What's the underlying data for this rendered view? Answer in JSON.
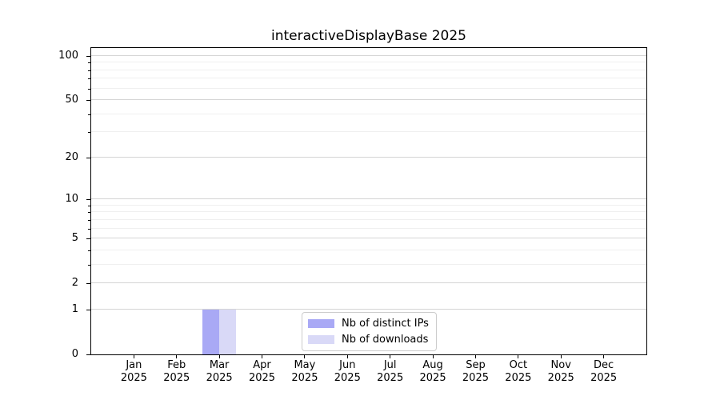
{
  "chart_data": {
    "type": "bar",
    "title": "interactiveDisplayBase 2025",
    "categories": [
      "Jan 2025",
      "Feb 2025",
      "Mar 2025",
      "Apr 2025",
      "May 2025",
      "Jun 2025",
      "Jul 2025",
      "Aug 2025",
      "Sep 2025",
      "Oct 2025",
      "Nov 2025",
      "Dec 2025"
    ],
    "series": [
      {
        "name": "Nb of distinct IPs",
        "color": "#a9a9f5",
        "values": [
          0,
          0,
          1,
          0,
          0,
          0,
          0,
          0,
          0,
          0,
          0,
          0
        ]
      },
      {
        "name": "Nb of downloads",
        "color": "#d9d9f7",
        "values": [
          0,
          0,
          1,
          0,
          0,
          0,
          0,
          0,
          0,
          0,
          0,
          0
        ]
      }
    ],
    "xlabel": "",
    "ylabel": "",
    "yscale": "log1p",
    "y_axis": {
      "major_ticks": [
        0,
        1,
        2,
        5,
        10,
        20,
        50,
        100
      ],
      "minor_gridlines": [
        3,
        4,
        6,
        7,
        8,
        9,
        30,
        40,
        60,
        70,
        80,
        90
      ],
      "max": 113.2
    },
    "grid": "horizontal",
    "legend_position": "lower center",
    "bar_width_fraction": 0.4
  },
  "colors": {
    "background": "#ffffff",
    "spine": "#000000",
    "major_grid": "#d5d5d5",
    "minor_grid": "#efefef",
    "legend_border": "#cccccc",
    "text": "#000000"
  }
}
